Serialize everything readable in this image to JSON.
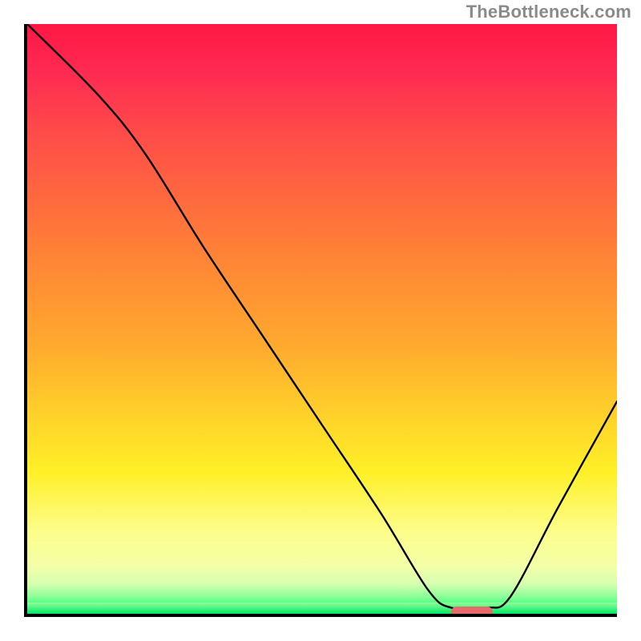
{
  "watermark": "TheBottleneck.com",
  "chart_data": {
    "type": "line",
    "title": "",
    "xlabel": "",
    "ylabel": "",
    "xlim": [
      0,
      100
    ],
    "ylim": [
      0,
      100
    ],
    "grid": false,
    "legend": false,
    "background": {
      "kind": "vertical-gradient",
      "stops": [
        {
          "pos": 0,
          "color": "#ff1744"
        },
        {
          "pos": 30,
          "color": "#ff6a3e"
        },
        {
          "pos": 55,
          "color": "#ffab2e"
        },
        {
          "pos": 76,
          "color": "#fff028"
        },
        {
          "pos": 92,
          "color": "#f3ffa8"
        },
        {
          "pos": 99,
          "color": "#2fff77"
        },
        {
          "pos": 100,
          "color": "#00e865"
        }
      ]
    },
    "series": [
      {
        "name": "bottleneck-curve",
        "x": [
          0,
          12,
          20,
          30,
          40,
          50,
          60,
          68,
          72,
          78,
          82,
          90,
          100
        ],
        "y": [
          100,
          88,
          78,
          62,
          47,
          32,
          17,
          4,
          1,
          1,
          3,
          18,
          36
        ]
      }
    ],
    "marker": {
      "name": "optimal-range",
      "x_center": 75,
      "y": 0.8,
      "width": 7,
      "color": "#e76b6b"
    }
  }
}
